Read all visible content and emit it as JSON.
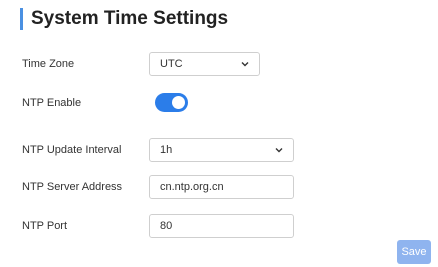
{
  "page": {
    "title": "System Time Settings"
  },
  "fields": {
    "time_zone": {
      "label": "Time Zone",
      "value": "UTC"
    },
    "ntp_enable": {
      "label": "NTP Enable",
      "enabled": true
    },
    "ntp_update_interval": {
      "label": "NTP Update Interval",
      "value": "1h"
    },
    "ntp_server_address": {
      "label": "NTP Server Address",
      "value": "cn.ntp.org.cn"
    },
    "ntp_port": {
      "label": "NTP Port",
      "value": "80"
    }
  },
  "actions": {
    "save_label": "Save"
  },
  "colors": {
    "accent": "#4a90e2",
    "toggle_on": "#2b7de9",
    "save_button": "#8fb4ef"
  }
}
